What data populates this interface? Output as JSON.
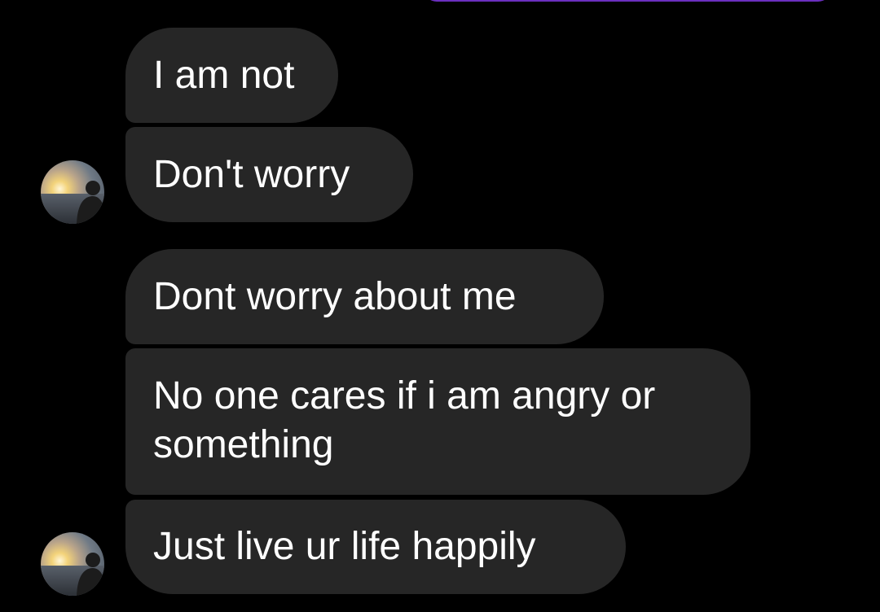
{
  "conversation": {
    "messages": [
      {
        "text": "I am not"
      },
      {
        "text": "Don't worry"
      },
      {
        "text": "Dont worry about me"
      },
      {
        "text": "No one cares if i am angry or something"
      },
      {
        "text": "Just live ur life happily"
      }
    ]
  },
  "colors": {
    "background": "#000000",
    "received_bubble": "#262626",
    "sent_bubble": "#6b2fbf",
    "text": "#ffffff"
  }
}
